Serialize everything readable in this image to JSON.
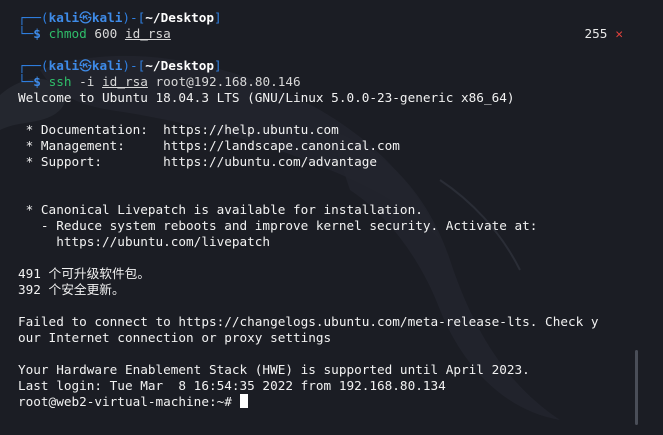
{
  "prompt1": {
    "user": "kali",
    "at_symbol": "㉿",
    "host": "kali",
    "cwd": "~/Desktop",
    "command": "chmod",
    "args_plain": " 600 ",
    "args_underlined": "id_rsa",
    "exit_code": "255",
    "exit_icon": "✕"
  },
  "prompt2": {
    "user": "kali",
    "at_symbol": "㉿",
    "host": "kali",
    "cwd": "~/Desktop",
    "command": "ssh",
    "args_plain": " -i ",
    "args_underlined": "id_rsa",
    "args_tail": " root@192.168.80.146"
  },
  "output": [
    "Welcome to Ubuntu 18.04.3 LTS (GNU/Linux 5.0.0-23-generic x86_64)",
    "",
    " * Documentation:  https://help.ubuntu.com",
    " * Management:     https://landscape.canonical.com",
    " * Support:        https://ubuntu.com/advantage",
    "",
    "",
    " * Canonical Livepatch is available for installation.",
    "   - Reduce system reboots and improve kernel security. Activate at:",
    "     https://ubuntu.com/livepatch",
    "",
    "491 个可升级软件包。",
    "392 个安全更新。",
    "",
    "Failed to connect to https://changelogs.ubuntu.com/meta-release-lts. Check y",
    "our Internet connection or proxy settings",
    "",
    "Your Hardware Enablement Stack (HWE) is supported until April 2023.",
    "Last login: Tue Mar  8 16:54:35 2022 from 192.168.80.134"
  ],
  "final_prompt": "root@web2-virtual-machine:~# ",
  "colors": {
    "background": "#1b1d24",
    "prompt_blue": "#3e8be8",
    "command_green": "#2fbe6a",
    "error_red": "#e2413c"
  }
}
